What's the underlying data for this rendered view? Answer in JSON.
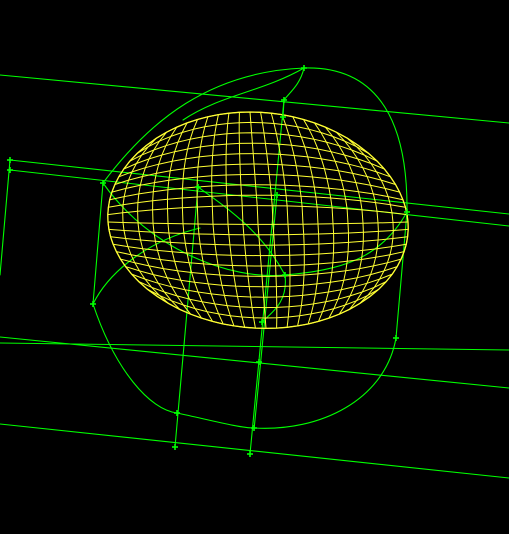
{
  "viewport": {
    "background": "#000000",
    "geometry_color": "#00ff00",
    "mesh_color": "#ffff33",
    "vertex_marker": "cross-icon"
  }
}
